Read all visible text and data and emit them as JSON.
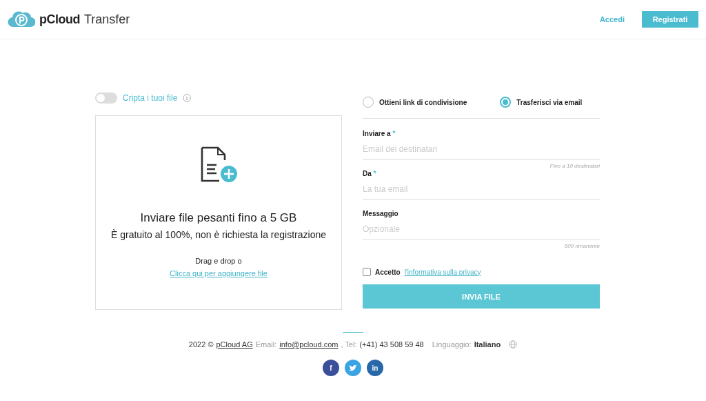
{
  "header": {
    "brand": "pCloud",
    "product": "Transfer",
    "login": "Accedi",
    "signup": "Registrati"
  },
  "encrypt": {
    "label": "Cripta i tuoi file",
    "on": false
  },
  "dropzone": {
    "title": "Inviare file pesanti fino a 5 GB",
    "subtitle": "È gratuito al 100%, non è richiesta la registrazione",
    "drag": "Drag e drop o",
    "link": "Clicca qui per aggiungere file"
  },
  "modes": [
    {
      "label": "Ottieni link di condivisione",
      "selected": false
    },
    {
      "label": "Trasferisci via email",
      "selected": true
    }
  ],
  "fields": [
    {
      "label": "Inviare a",
      "required_mark": "*",
      "placeholder": "Email dei destinatari",
      "hint": "Fino a 10 destinatari"
    },
    {
      "label": "Da",
      "required_mark": "*",
      "placeholder": "La tua email"
    },
    {
      "label": "Messaggio",
      "placeholder": "Opzionale",
      "hint": "500 rimanente"
    }
  ],
  "privacy": {
    "checked": false,
    "label": "Accetto",
    "link": "l'informativa sulla privacy"
  },
  "submit": "INVIA FILE",
  "footer": {
    "year": "2022 ©",
    "company": "pCloud AG",
    "email_label": "Email:",
    "email": "info@pcloud.com",
    "tel_label": ", Tel:",
    "tel": "(+41) 43 508 59 48",
    "lang_label": "Linguaggio:",
    "lang": "Italiano"
  },
  "socials": [
    {
      "kind": "letter",
      "text": "f",
      "color": "#3b4f9a"
    },
    {
      "kind": "bird",
      "color": "#3aa3e3"
    },
    {
      "kind": "letter",
      "text": "in",
      "color": "#2867a8"
    }
  ]
}
